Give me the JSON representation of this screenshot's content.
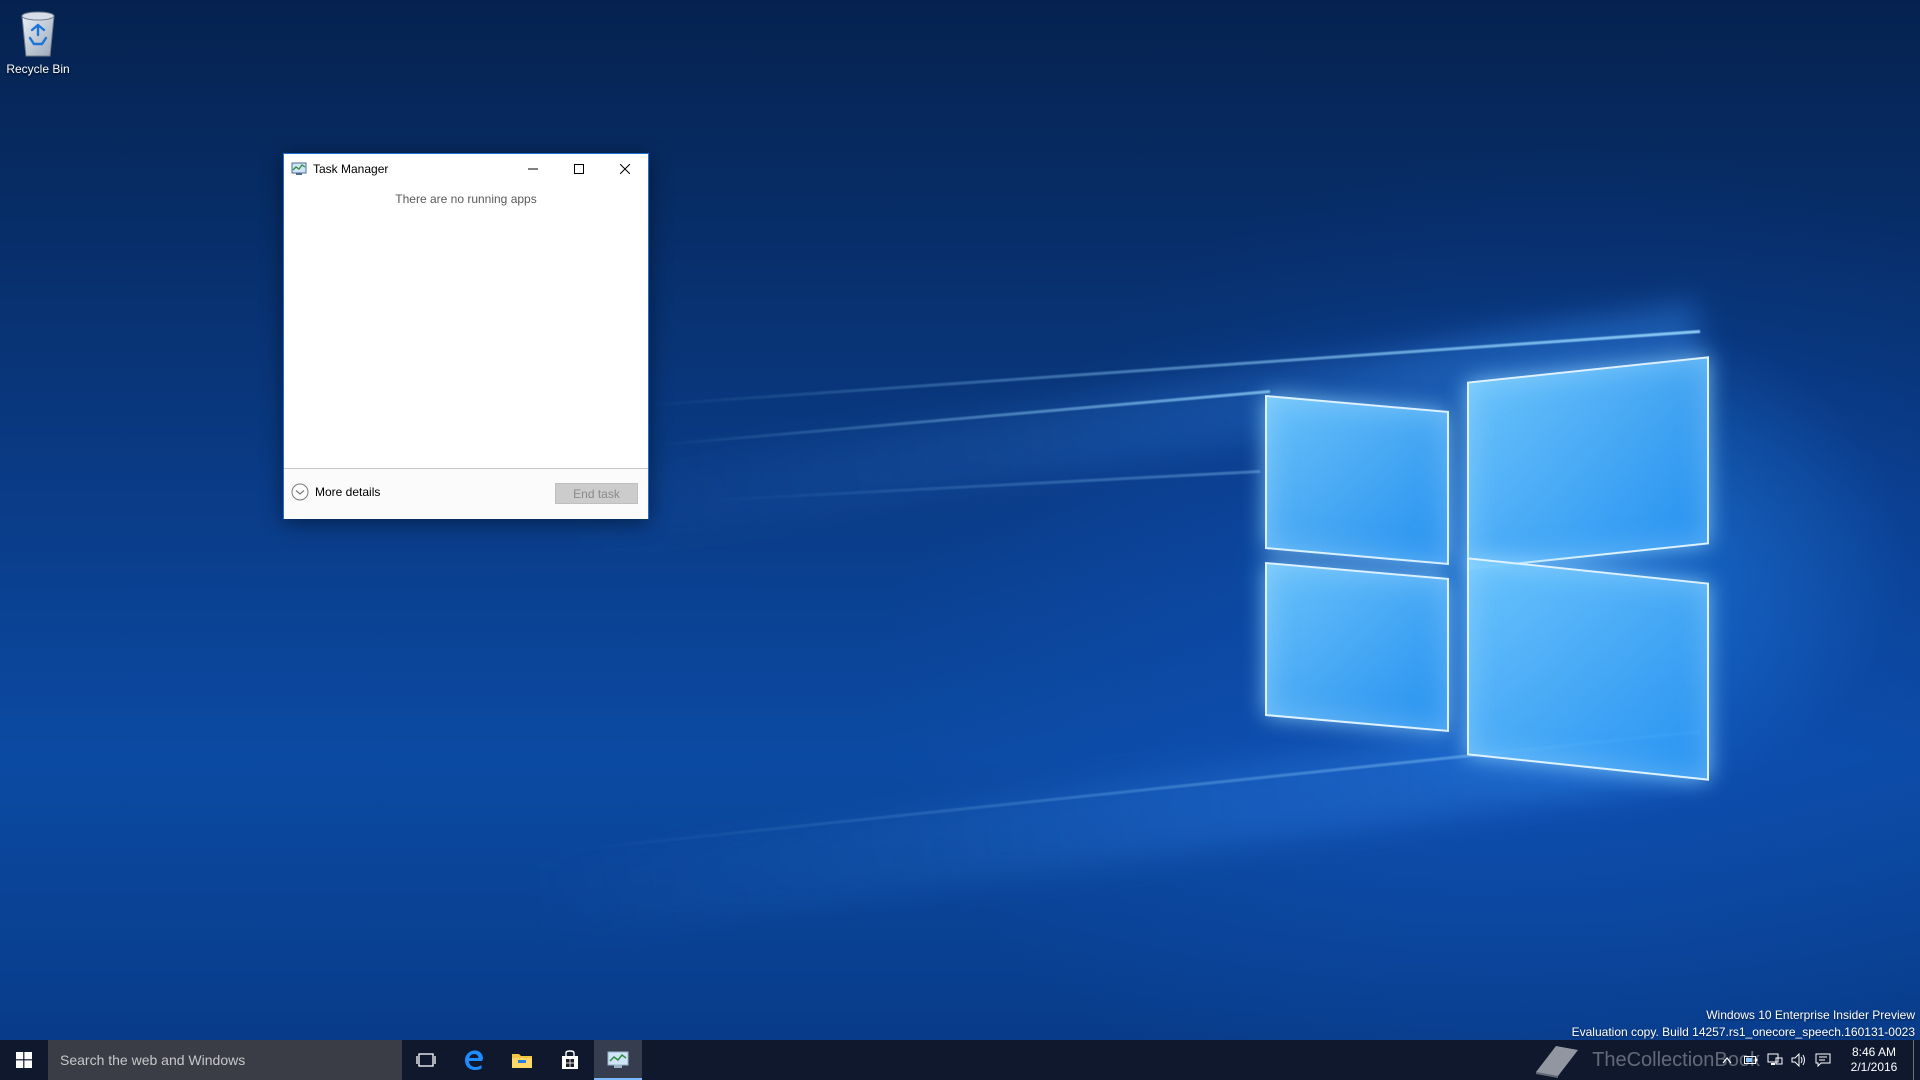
{
  "desktop": {
    "recycle_bin_label": "Recycle Bin"
  },
  "task_manager": {
    "title": "Task Manager",
    "empty_message": "There are no running apps",
    "more_details_label": "More details",
    "end_task_label": "End task",
    "icons": {
      "app": "task-manager-icon",
      "minimize": "minimize-icon",
      "maximize": "maximize-icon",
      "close": "close-icon",
      "more_details": "chevron-down-circle-icon"
    }
  },
  "watermark": {
    "line1": "Windows 10 Enterprise Insider Preview",
    "line2": "Evaluation copy. Build 14257.rs1_onecore_speech.160131-0023"
  },
  "taskbar": {
    "search_placeholder": "Search the web and Windows",
    "pinned": [
      {
        "name": "task-view-icon"
      },
      {
        "name": "edge-icon"
      },
      {
        "name": "file-explorer-icon"
      },
      {
        "name": "store-icon"
      },
      {
        "name": "task-manager-icon",
        "active": true
      }
    ],
    "brand_text": "TheCollectionBook",
    "clock": {
      "time": "8:46 AM",
      "date": "2/1/2016"
    },
    "tray_icons": [
      "chevron-up-icon",
      "battery-icon",
      "network-icon",
      "volume-icon",
      "action-center-icon"
    ]
  },
  "colors": {
    "accent": "#1f6fcf",
    "taskbar": "#10162a",
    "search_box": "#3a3d45"
  }
}
